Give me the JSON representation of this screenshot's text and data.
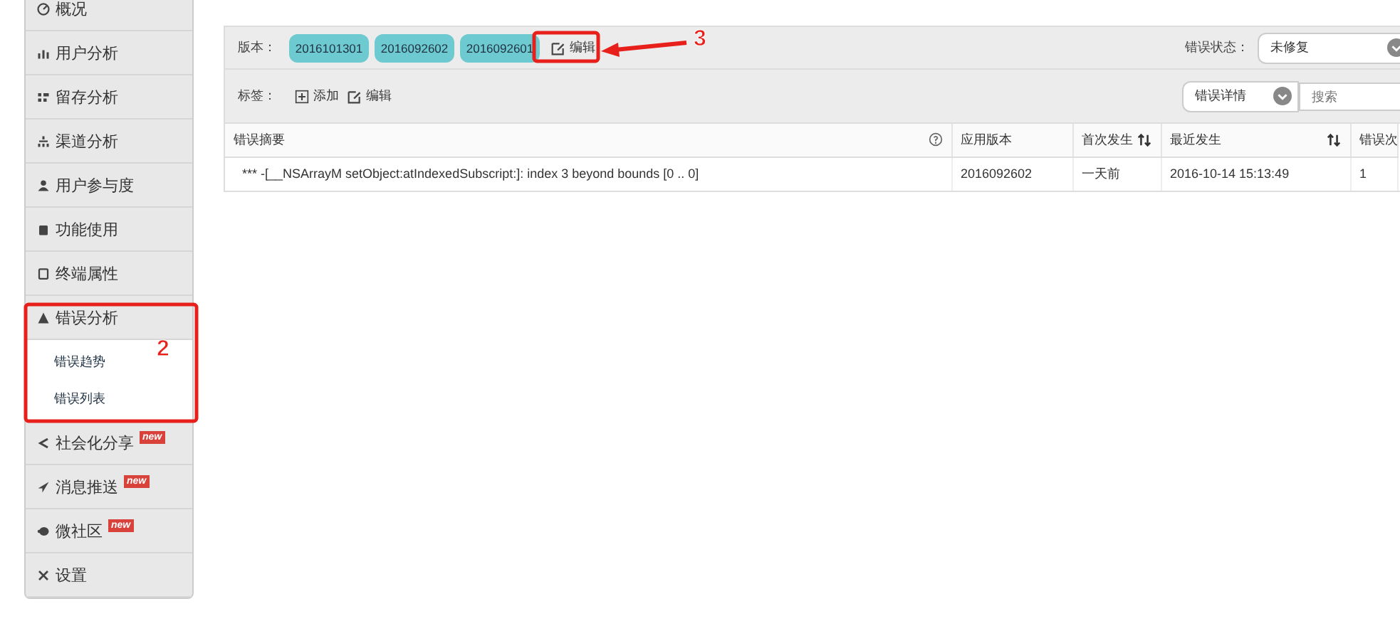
{
  "sidebar": {
    "items": [
      {
        "label": "概况"
      },
      {
        "label": "用户分析"
      },
      {
        "label": "留存分析"
      },
      {
        "label": "渠道分析"
      },
      {
        "label": "用户参与度"
      },
      {
        "label": "功能使用"
      },
      {
        "label": "终端属性"
      },
      {
        "label": "错误分析",
        "expanded": true,
        "children": [
          {
            "label": "错误趋势"
          },
          {
            "label": "错误列表"
          }
        ]
      },
      {
        "label": "社会化分享",
        "badge": "new"
      },
      {
        "label": "消息推送",
        "badge": "new"
      },
      {
        "label": "微社区",
        "badge": "new"
      },
      {
        "label": "设置"
      }
    ]
  },
  "filters": {
    "version_label": "版本：",
    "versions": [
      "2016101301",
      "2016092602",
      "2016092601"
    ],
    "version_edit": "编辑",
    "status_label": "错误状态：",
    "status_value": "未修复",
    "tag_label": "标签：",
    "tag_add": "添加",
    "tag_edit": "编辑",
    "detail_select": "错误详情",
    "search": {
      "placeholder": "搜索"
    }
  },
  "table": {
    "columns": [
      {
        "label": "错误摘要",
        "help": true,
        "sortable": false
      },
      {
        "label": "应用版本",
        "help": false,
        "sortable": false
      },
      {
        "label": "首次发生",
        "help": false,
        "sortable": true
      },
      {
        "label": "最近发生",
        "help": false,
        "sortable": true
      },
      {
        "label": "错误次"
      }
    ],
    "rows": [
      [
        "*** -[__NSArrayM setObject:atIndexedSubscript:]: index 3 beyond bounds [0 .. 0]",
        "2016092602",
        "一天前",
        "2016-10-14 15:13:49",
        "1"
      ]
    ]
  },
  "annotations": [
    {
      "label": "2"
    },
    {
      "label": "3"
    }
  ]
}
